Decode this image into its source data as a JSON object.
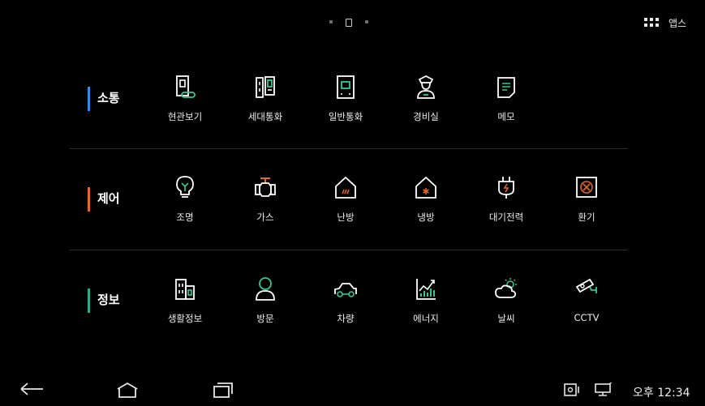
{
  "apps": {
    "label": "앱스"
  },
  "categories": [
    {
      "title": "소통",
      "accent": "#2f8ee6",
      "items": [
        {
          "label": "현관보기",
          "icon": "door-camera-icon"
        },
        {
          "label": "세대통화",
          "icon": "intercom-icon"
        },
        {
          "label": "일반통화",
          "icon": "phone-icon"
        },
        {
          "label": "경비실",
          "icon": "guard-icon"
        },
        {
          "label": "메모",
          "icon": "memo-icon"
        }
      ]
    },
    {
      "title": "제어",
      "accent": "#e2672b",
      "items": [
        {
          "label": "조명",
          "icon": "bulb-icon"
        },
        {
          "label": "가스",
          "icon": "gas-valve-icon"
        },
        {
          "label": "난방",
          "icon": "heating-icon"
        },
        {
          "label": "냉방",
          "icon": "cooling-icon"
        },
        {
          "label": "대기전력",
          "icon": "standby-power-icon"
        },
        {
          "label": "환기",
          "icon": "ventilation-icon"
        }
      ]
    },
    {
      "title": "정보",
      "accent": "#2dab8a",
      "items": [
        {
          "label": "생활정보",
          "icon": "building-icon"
        },
        {
          "label": "방문",
          "icon": "visitor-icon"
        },
        {
          "label": "차량",
          "icon": "car-icon"
        },
        {
          "label": "에너지",
          "icon": "energy-chart-icon"
        },
        {
          "label": "날씨",
          "icon": "weather-icon"
        },
        {
          "label": "CCTV",
          "icon": "cctv-icon"
        }
      ]
    }
  ],
  "status_bar": {
    "time": "오후 12:34"
  },
  "colors": {
    "accent_icon": "#35c79a",
    "icon_stroke": "#ffffff",
    "background": "#000000"
  }
}
